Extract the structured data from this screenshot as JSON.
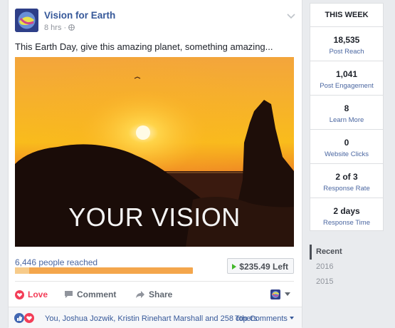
{
  "post": {
    "page_name": "Vision for Earth",
    "time": "8 hrs",
    "text": "This Earth Day, give this amazing planet, something amazing...",
    "image_caption": "YOUR VISION",
    "reach_text": "6,446 people reached",
    "reach_fraction": 0.08,
    "budget_left": "$235.49 Left",
    "actions": {
      "love": "Love",
      "comment": "Comment",
      "share": "Share"
    },
    "reactions_text": "You, Joshua Jozwik, Kristin Rinehart Marshall and 258 others",
    "top_comments": "Top Comments"
  },
  "this_week": {
    "title": "THIS WEEK",
    "stats": [
      {
        "value": "18,535",
        "label": "Post Reach"
      },
      {
        "value": "1,041",
        "label": "Post Engagement"
      },
      {
        "value": "8",
        "label": "Learn More"
      },
      {
        "value": "0",
        "label": "Website Clicks"
      },
      {
        "value": "2 of 3",
        "label": "Response Rate"
      },
      {
        "value": "2 days",
        "label": "Response Time"
      }
    ]
  },
  "years": [
    {
      "label": "Recent",
      "active": true
    },
    {
      "label": "2016",
      "active": false
    },
    {
      "label": "2015",
      "active": false
    }
  ],
  "colors": {
    "link": "#365899",
    "love": "#f33e58",
    "like": "#4267b2",
    "bar": "#f4a64c"
  }
}
